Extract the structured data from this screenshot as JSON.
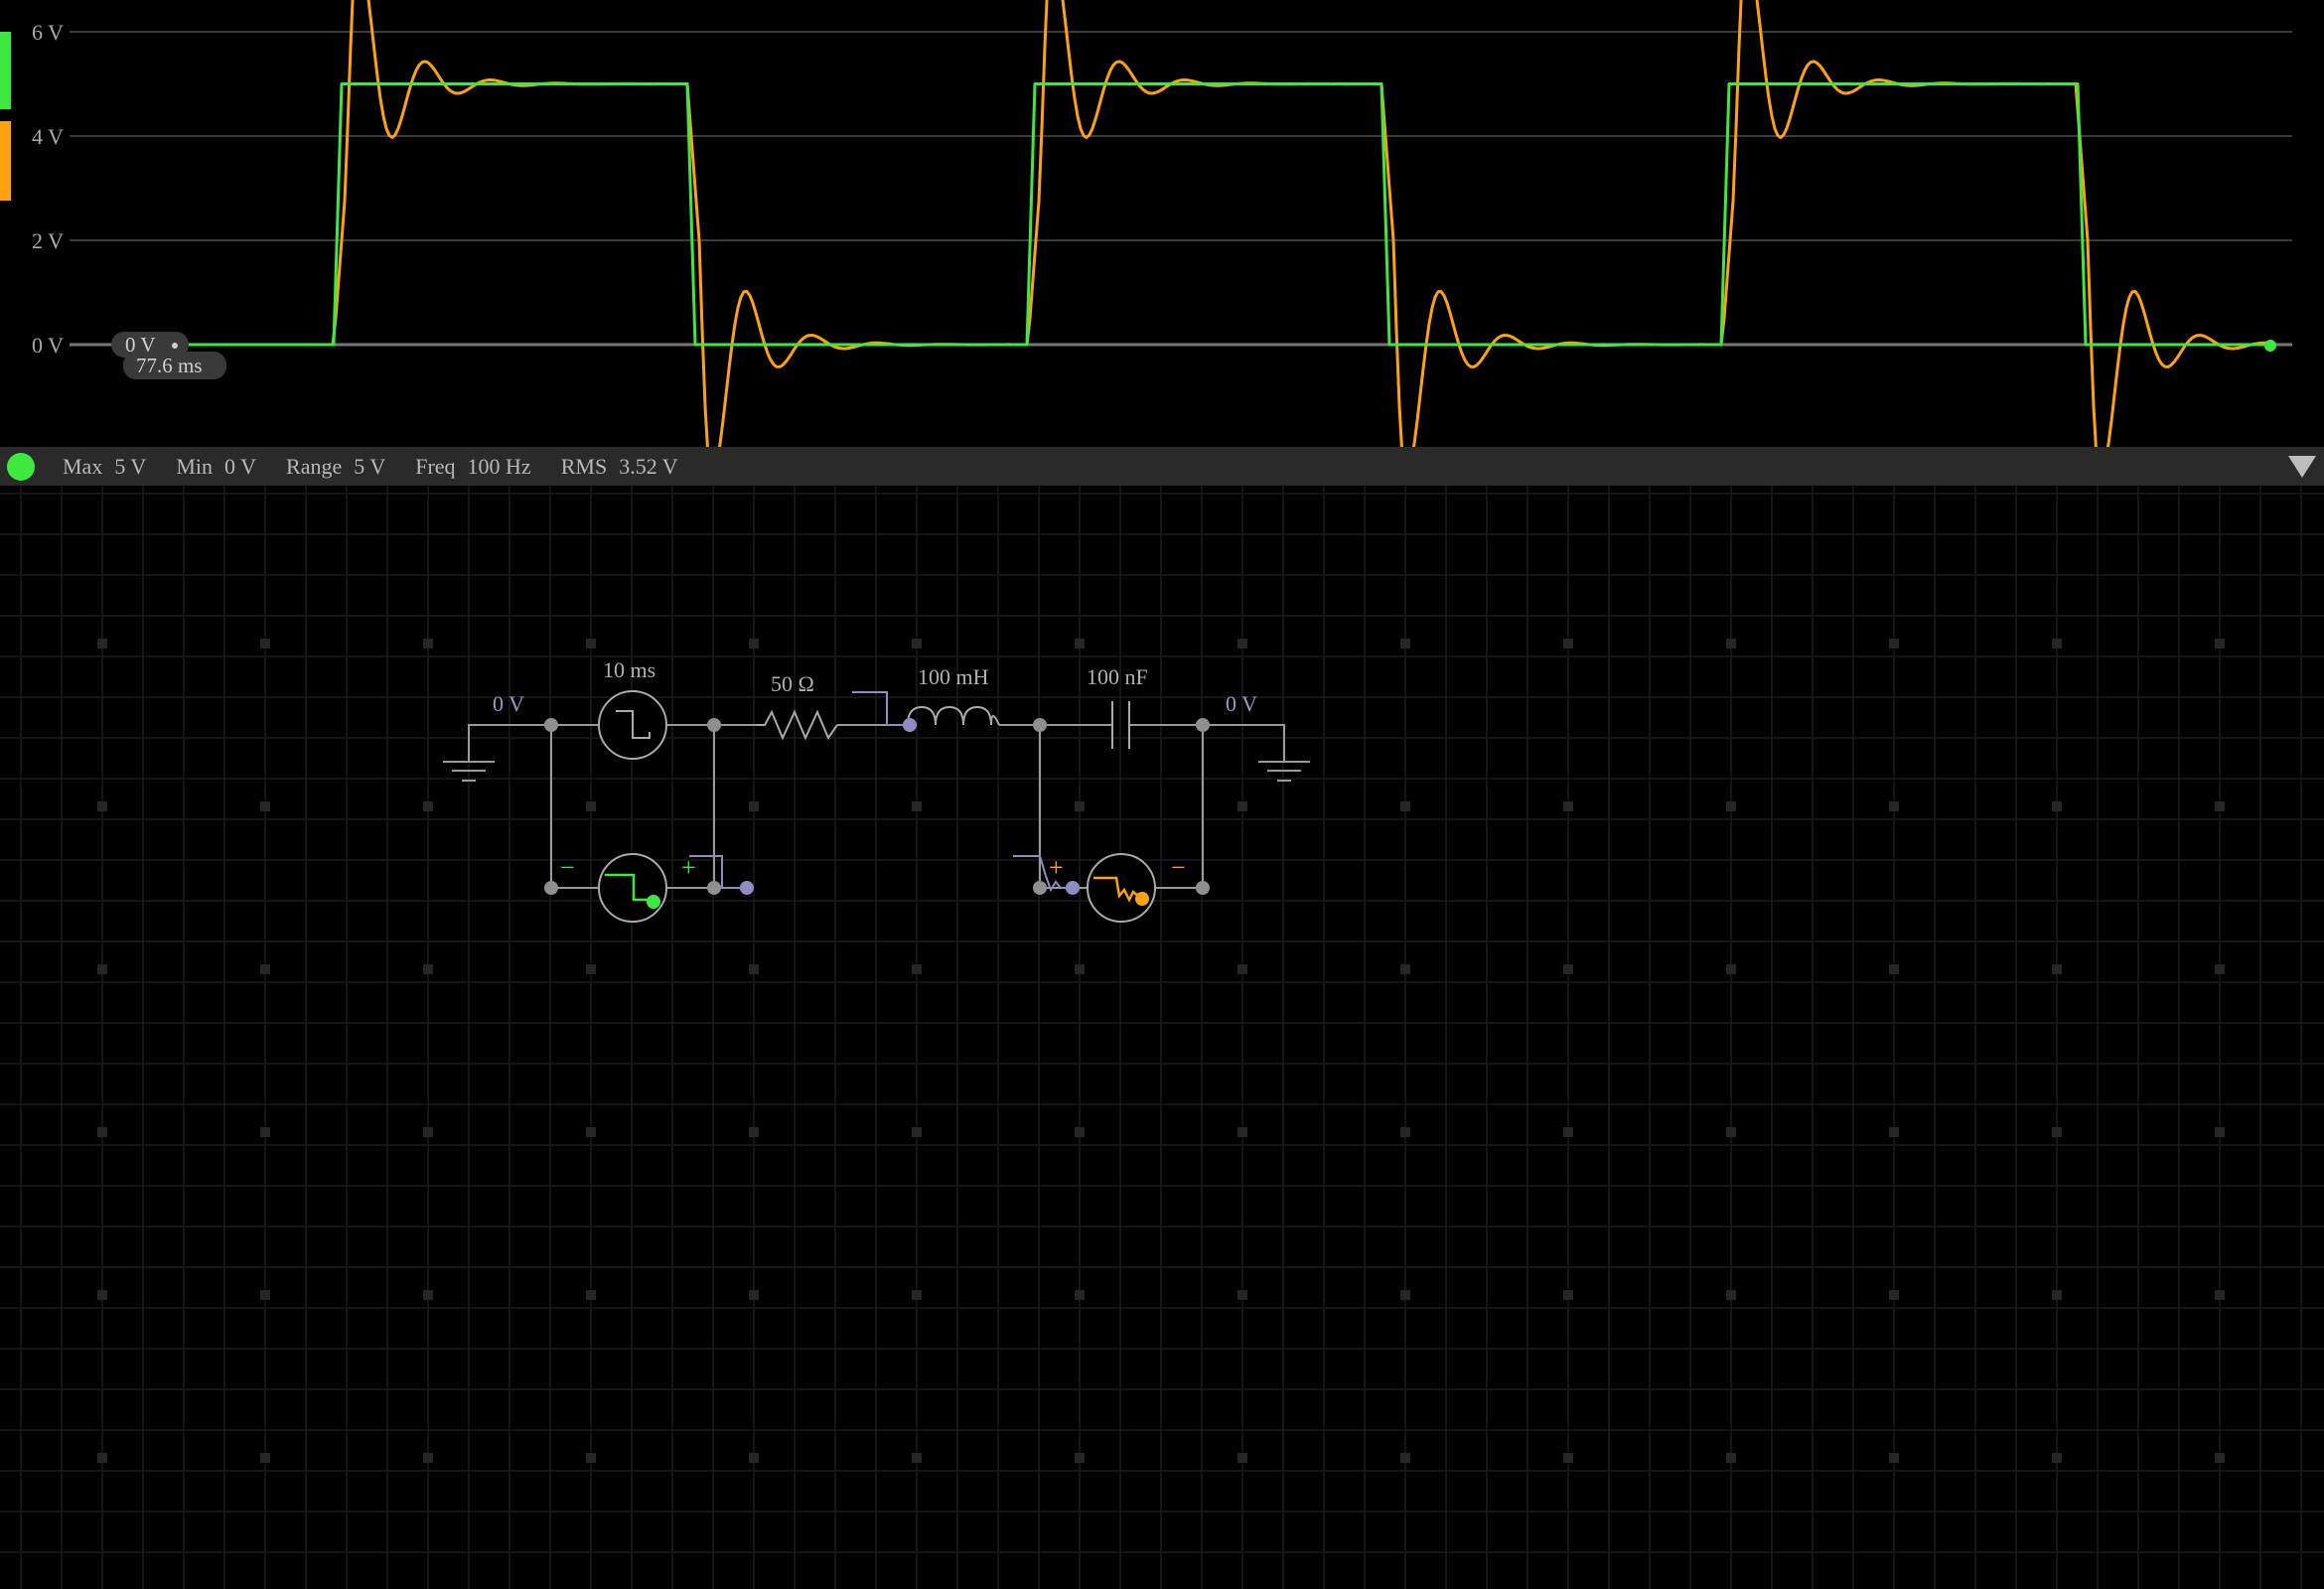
{
  "scope": {
    "y_axis_labels": [
      "6 V",
      "4 V",
      "2 V",
      "0 V"
    ],
    "y_axis_values": [
      6,
      4,
      2,
      0
    ],
    "cursor_voltage": "0 V",
    "cursor_time": "77.6 ms",
    "channel_colors": [
      "#3ee93e",
      "#ffa20f"
    ]
  },
  "chart_data": {
    "type": "line",
    "ylim": [
      -1,
      6.3
    ],
    "ytick_labels": [
      "6 V",
      "4 V",
      "2 V",
      "0 V"
    ],
    "grid": true,
    "period_ms": 10,
    "series": [
      {
        "color": "#3ee93e",
        "waveform": "square",
        "low": 0,
        "high": 5
      },
      {
        "color": "#ffa20f",
        "waveform": "damped square response",
        "low": 0,
        "high": 5,
        "peak": 6.0,
        "trough": -0.95
      }
    ]
  },
  "stats": {
    "color": "#3ee93e",
    "max_label": "Max",
    "max_value": "5 V",
    "min_label": "Min",
    "min_value": "0 V",
    "range_label": "Range",
    "range_value": "5 V",
    "freq_label": "Freq",
    "freq_value": "100 Hz",
    "rms_label": "RMS",
    "rms_value": "3.52 V"
  },
  "circuit": {
    "ground_left_label": "0 V",
    "source_label": "10 ms",
    "resistor_label": "50 Ω",
    "inductor_label": "100 mH",
    "capacitor_label": "100 nF",
    "ground_right_label": "0 V",
    "probe1": {
      "minus": "−",
      "plus": "+",
      "color": "#3ee93e"
    },
    "probe2": {
      "minus": "−",
      "plus": "+",
      "color": "#ffa20f"
    },
    "wire_color": "#9a9a9a",
    "node_color": "#8f8f8f",
    "probe_wire_color": "#8d8dc4"
  }
}
